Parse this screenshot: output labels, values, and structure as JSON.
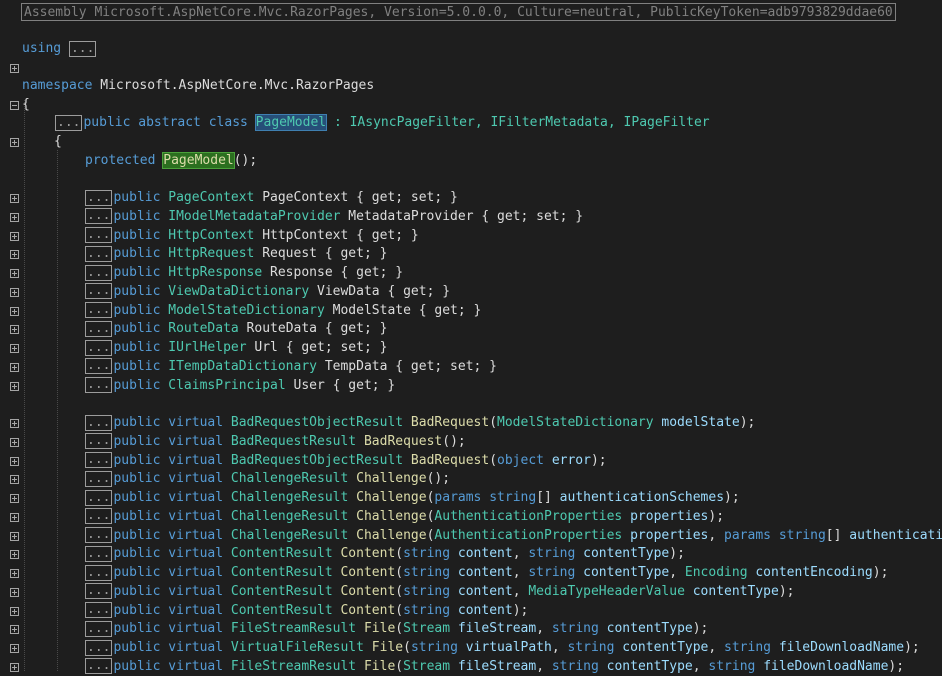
{
  "assembly_line": "Assembly Microsoft.AspNetCore.Mvc.RazorPages, Version=5.0.0.0, Culture=neutral, PublicKeyToken=adb9793829ddae60",
  "using_kw": "using",
  "collapsed_marker": "...",
  "namespace": {
    "kw": "namespace",
    "name": "Microsoft.AspNetCore.Mvc.RazorPages"
  },
  "open_brace": "{",
  "class_decl": {
    "modifiers": "public abstract class ",
    "name": "PageModel",
    "bases": " : IAsyncPageFilter, IFilterMetadata, IPageFilter"
  },
  "ctor": {
    "kw": "protected ",
    "name": "PageModel",
    "rest": "();"
  },
  "properties": [
    {
      "type": "PageContext",
      "rest": " PageContext { get; set; }"
    },
    {
      "type": "IModelMetadataProvider",
      "rest": " MetadataProvider { get; set; }"
    },
    {
      "type": "HttpContext",
      "rest": " HttpContext { get; }"
    },
    {
      "type": "HttpRequest",
      "rest": " Request { get; }"
    },
    {
      "type": "HttpResponse",
      "rest": " Response { get; }"
    },
    {
      "type": "ViewDataDictionary",
      "rest": " ViewData { get; }"
    },
    {
      "type": "ModelStateDictionary",
      "rest": " ModelState { get; }"
    },
    {
      "type": "RouteData",
      "rest": " RouteData { get; }"
    },
    {
      "type": "IUrlHelper",
      "rest": " Url { get; set; }"
    },
    {
      "type": "ITempDataDictionary",
      "rest": " TempData { get; set; }"
    },
    {
      "type": "ClaimsPrincipal",
      "rest": " User { get; }"
    }
  ],
  "methods": [
    {
      "ret": "BadRequestObjectResult",
      "name": "BadRequest",
      "params": [
        [
          "ModelStateDictionary",
          "modelState"
        ]
      ],
      "tail": ");"
    },
    {
      "ret": "BadRequestResult",
      "name": "BadRequest",
      "params": [],
      "tail": ");"
    },
    {
      "ret": "BadRequestObjectResult",
      "name": "BadRequest",
      "params": [
        [
          "object",
          "error"
        ]
      ],
      "tail": ");"
    },
    {
      "ret": "ChallengeResult",
      "name": "Challenge",
      "params": [],
      "tail": ");"
    },
    {
      "ret": "ChallengeResult",
      "name": "Challenge",
      "params": [
        [
          "params string[]",
          "authenticationSchemes"
        ]
      ],
      "tail": ");"
    },
    {
      "ret": "ChallengeResult",
      "name": "Challenge",
      "params": [
        [
          "AuthenticationProperties",
          "properties"
        ]
      ],
      "tail": ");"
    },
    {
      "ret": "ChallengeResult",
      "name": "Challenge",
      "params": [
        [
          "AuthenticationProperties",
          "properties"
        ],
        [
          "params string[]",
          "authenticati"
        ]
      ],
      "tail": ""
    },
    {
      "ret": "ContentResult",
      "name": "Content",
      "params": [
        [
          "string",
          "content"
        ],
        [
          "string",
          "contentType"
        ]
      ],
      "tail": ");"
    },
    {
      "ret": "ContentResult",
      "name": "Content",
      "params": [
        [
          "string",
          "content"
        ],
        [
          "string",
          "contentType"
        ],
        [
          "Encoding",
          "contentEncoding"
        ]
      ],
      "tail": ");"
    },
    {
      "ret": "ContentResult",
      "name": "Content",
      "params": [
        [
          "string",
          "content"
        ],
        [
          "MediaTypeHeaderValue",
          "contentType"
        ]
      ],
      "tail": ");"
    },
    {
      "ret": "ContentResult",
      "name": "Content",
      "params": [
        [
          "string",
          "content"
        ]
      ],
      "tail": ");"
    },
    {
      "ret": "FileStreamResult",
      "name": "File",
      "params": [
        [
          "Stream",
          "fileStream"
        ],
        [
          "string",
          "contentType"
        ]
      ],
      "tail": ");"
    },
    {
      "ret": "VirtualFileResult",
      "name": "File",
      "params": [
        [
          "string",
          "virtualPath"
        ],
        [
          "string",
          "contentType"
        ],
        [
          "string",
          "fileDownloadName"
        ]
      ],
      "tail": ");"
    },
    {
      "ret": "FileStreamResult",
      "name": "File",
      "params": [
        [
          "Stream",
          "fileStream"
        ],
        [
          "string",
          "contentType"
        ],
        [
          "string",
          "fileDownloadName"
        ]
      ],
      "tail": ");"
    }
  ],
  "member_kw": "public",
  "virtual_kw": "virtual"
}
